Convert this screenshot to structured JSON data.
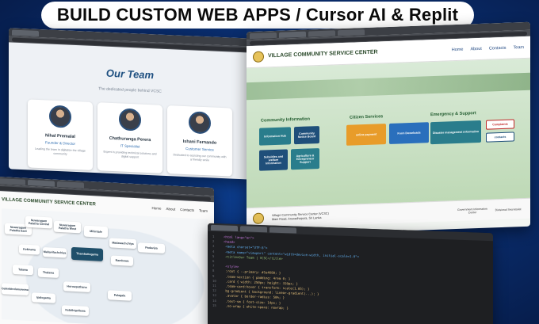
{
  "banner": {
    "title": "BUILD CUSTOM WEB APPS / Cursor AI & Replit"
  },
  "team_page": {
    "title": "Our Team",
    "subtitle": "The dedicated people behind VCSC",
    "members": [
      {
        "name": "Nihal Premalal",
        "role": "Founder & Director",
        "desc": "Leading the team in digitalize the village community"
      },
      {
        "name": "Chathuranga Perera",
        "role": "IT Specialist",
        "desc": "Expert in providing technical solutions and digital support"
      },
      {
        "name": "Ishani Fernando",
        "role": "Customer Service",
        "desc": "Dedicated to assisting our community with a friendly smile"
      }
    ]
  },
  "vcsc_page": {
    "title": "VILLAGE COMMUNITY SERVICE CENTER",
    "nav": [
      "Home",
      "About",
      "Contacts",
      "Team"
    ],
    "sections": [
      "Community Information",
      "Citizen Services",
      "Emergency & Support"
    ],
    "tiles": {
      "community": [
        "Information Hub",
        "Community Notice Board",
        "Subsidies and welfare Information",
        "Agriculture & Entrepreneur Support"
      ],
      "citizen": [
        "online payment",
        "Form Downloads"
      ],
      "emergency": [
        "Disaster management information",
        "Complaints",
        "contacts"
      ]
    },
    "footer": {
      "org": "Village Community Service Center (VCSC)",
      "addr": "Main Road, Anuradhapura, Sri Lanka",
      "seal1": "Government Information Center",
      "seal2": "Divisional Secretariat"
    }
  },
  "map_page": {
    "title": "VILLAGE COMMUNITY SERVICE CENTER",
    "nav": [
      "Home",
      "About",
      "Contacts",
      "Team"
    ],
    "tiles": [
      "Nuwaragam Palatha East",
      "Nuwaragam Palatha Central",
      "Nuwaragam Palatha West",
      "Mihintale",
      "Thambuttegama",
      "Madawachchiya",
      "Kekirawa",
      "Rambewa",
      "Palagala",
      "Talawa",
      "Thalawa",
      "Mahavilachchiya",
      "Galenbindunuwewa",
      "Ipalogama",
      "Horowpothana",
      "Padaviya",
      "Kebithigollewa"
    ],
    "selected": "Thambuttegama"
  },
  "code_page": {
    "lines": [
      "<html lang=\"en\">",
      "<head>",
      "  <meta charset=\"UTF-8\">",
      "  <meta name=\"viewport\" content=\"width=device-width, initial-scale=1.0\">",
      "  <title>Our Team | VCSC</title>",
      "",
      "  <style>",
      "    :root { --primary: #1e4680; }",
      "    .team-section { padding: 4rem 0; }",
      "    .card { width: 250px; height: 320px; }",
      "    .team-card:hover { transform: scale(1.05); }",
      "    bg-gradient { background: linear-gradient(...); }",
      "    .avatar { border-radius: 50%; }",
      "    .text-sm { font-size: 14px; }",
      "    .no-wrap { white-space: nowrap; }"
    ]
  }
}
